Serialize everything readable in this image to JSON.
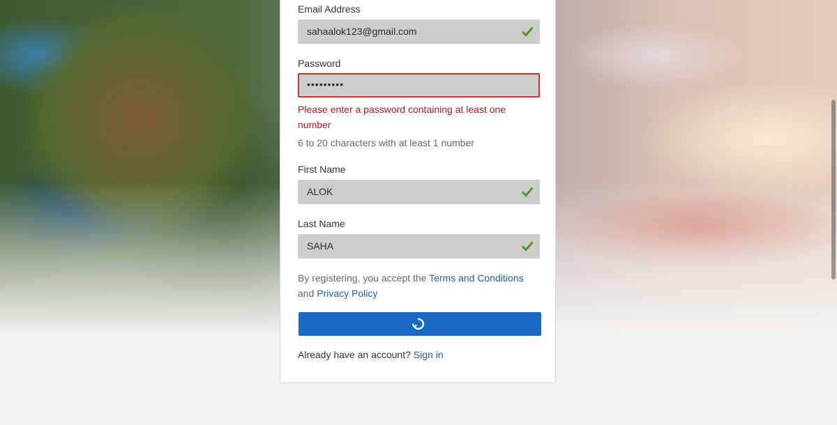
{
  "form": {
    "email": {
      "label": "Email Address",
      "value": "sahaalok123@gmail.com",
      "valid": true,
      "icon": "checkmark-icon"
    },
    "password": {
      "label": "Password",
      "value": "•••••••••",
      "error": "Please enter a password containing at least one number",
      "hint": "6 to 20 characters with at least 1 number"
    },
    "first_name": {
      "label": "First Name",
      "value": "ALOK",
      "valid": true,
      "icon": "checkmark-icon"
    },
    "last_name": {
      "label": "Last Name",
      "value": "SAHA",
      "valid": true,
      "icon": "checkmark-icon"
    },
    "terms": {
      "prefix": "By registering, you accept the ",
      "terms_link": "Terms and Conditions",
      "middle": " and ",
      "privacy_link": "Privacy Policy"
    },
    "submit": {
      "state": "loading",
      "icon": "loading-spinner-icon"
    },
    "signin": {
      "prefix": "Already have an account? ",
      "link": "Sign in"
    }
  },
  "colors": {
    "accent": "#1b6ac2",
    "error": "#b5191c",
    "valid": "#4a9a1f",
    "link": "#1a5eaf"
  }
}
